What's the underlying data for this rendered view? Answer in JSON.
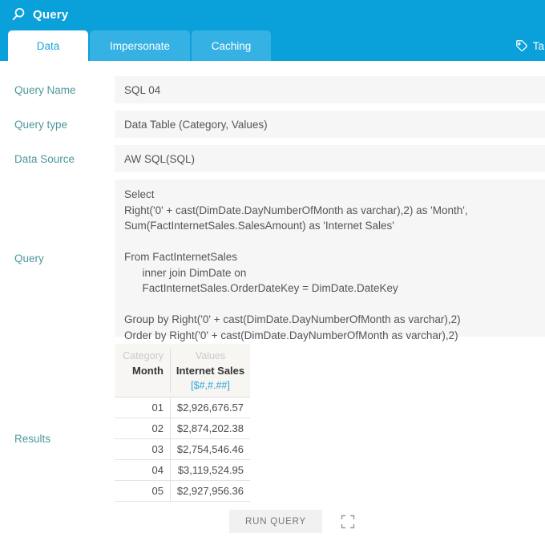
{
  "titlebar": {
    "title": "Query"
  },
  "tabs": {
    "items": [
      {
        "label": "Data",
        "active": true
      },
      {
        "label": "Impersonate",
        "active": false
      },
      {
        "label": "Caching",
        "active": false
      }
    ],
    "tags_label": "Ta"
  },
  "form": {
    "fields": [
      {
        "label": "Query Name",
        "value": "SQL 04"
      },
      {
        "label": "Query type",
        "value": "Data Table (Category, Values)"
      },
      {
        "label": "Data Source",
        "value": "AW SQL(SQL)"
      },
      {
        "label": "Query",
        "value": "Select\nRight('0' + cast(DimDate.DayNumberOfMonth as varchar),2) as 'Month',\nSum(FactInternetSales.SalesAmount) as 'Internet Sales'\n\nFrom FactInternetSales\n      inner join DimDate on\n      FactInternetSales.OrderDateKey = DimDate.DateKey\n\nGroup by Right('0' + cast(DimDate.DayNumberOfMonth as varchar),2)\nOrder by Right('0' + cast(DimDate.DayNumberOfMonth as varchar),2)"
      }
    ]
  },
  "results": {
    "label": "Results",
    "table": {
      "group_headers": [
        "Category",
        "Values"
      ],
      "column_headers": [
        "Month",
        "Internet Sales"
      ],
      "format": "[$#,#.##]",
      "rows": [
        [
          "01",
          "$2,926,676.57"
        ],
        [
          "02",
          "$2,874,202.38"
        ],
        [
          "03",
          "$2,754,546.46"
        ],
        [
          "04",
          "$3,119,524.95"
        ],
        [
          "05",
          "$2,927,956.36"
        ]
      ]
    }
  },
  "actions": {
    "run_query_label": "RUN QUERY"
  },
  "colors": {
    "accent_cyan": "#0aa0d9",
    "tab_inactive_cyan": "#36b1e4",
    "label_teal": "#4e979c",
    "format_blue": "#2aa3da"
  }
}
